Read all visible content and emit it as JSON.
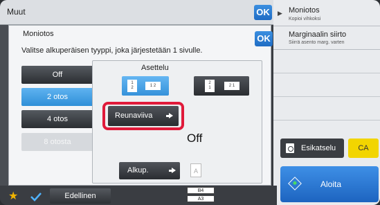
{
  "topbar": {
    "title": "Muut",
    "ok": "OK"
  },
  "right_panel": {
    "items": [
      {
        "title": "Moniotos",
        "subtitle": "Kopioi vihkoksi"
      },
      {
        "title": "Marginaalin siirto",
        "subtitle": "Siirrä asento marg. varten"
      }
    ],
    "preview_label": "Esikatselu",
    "ca_label": "CA",
    "start_label": "Aloita"
  },
  "dialog": {
    "title": "Moniotos",
    "ok": "OK",
    "instruction": "Valitse alkuperäisen tyyppi, joka järjestetään 1 sivulle.",
    "options": [
      {
        "label": "Off",
        "state": "normal"
      },
      {
        "label": "2 otos",
        "state": "selected"
      },
      {
        "label": "4 otos",
        "state": "normal"
      },
      {
        "label": "8 otosta",
        "state": "disabled"
      }
    ],
    "layout_title": "Asettelu",
    "layout_options": [
      {
        "a": "1",
        "b": "2",
        "c": "1",
        "d": "2",
        "selected": true
      },
      {
        "a": "2",
        "b": "1",
        "c": "2",
        "d": "1",
        "selected": false
      }
    ],
    "border_button": "Reunaviiva",
    "border_value": "Off",
    "orig_button": "Alkup.",
    "orig_icon_letter": "A"
  },
  "bottom": {
    "back_label": "Edellinen",
    "paper_sizes": [
      "B4",
      "A3"
    ]
  },
  "colors": {
    "accent_blue": "#2f8fd8",
    "highlight_red": "#e01a3a",
    "ca_yellow": "#f2d500"
  }
}
